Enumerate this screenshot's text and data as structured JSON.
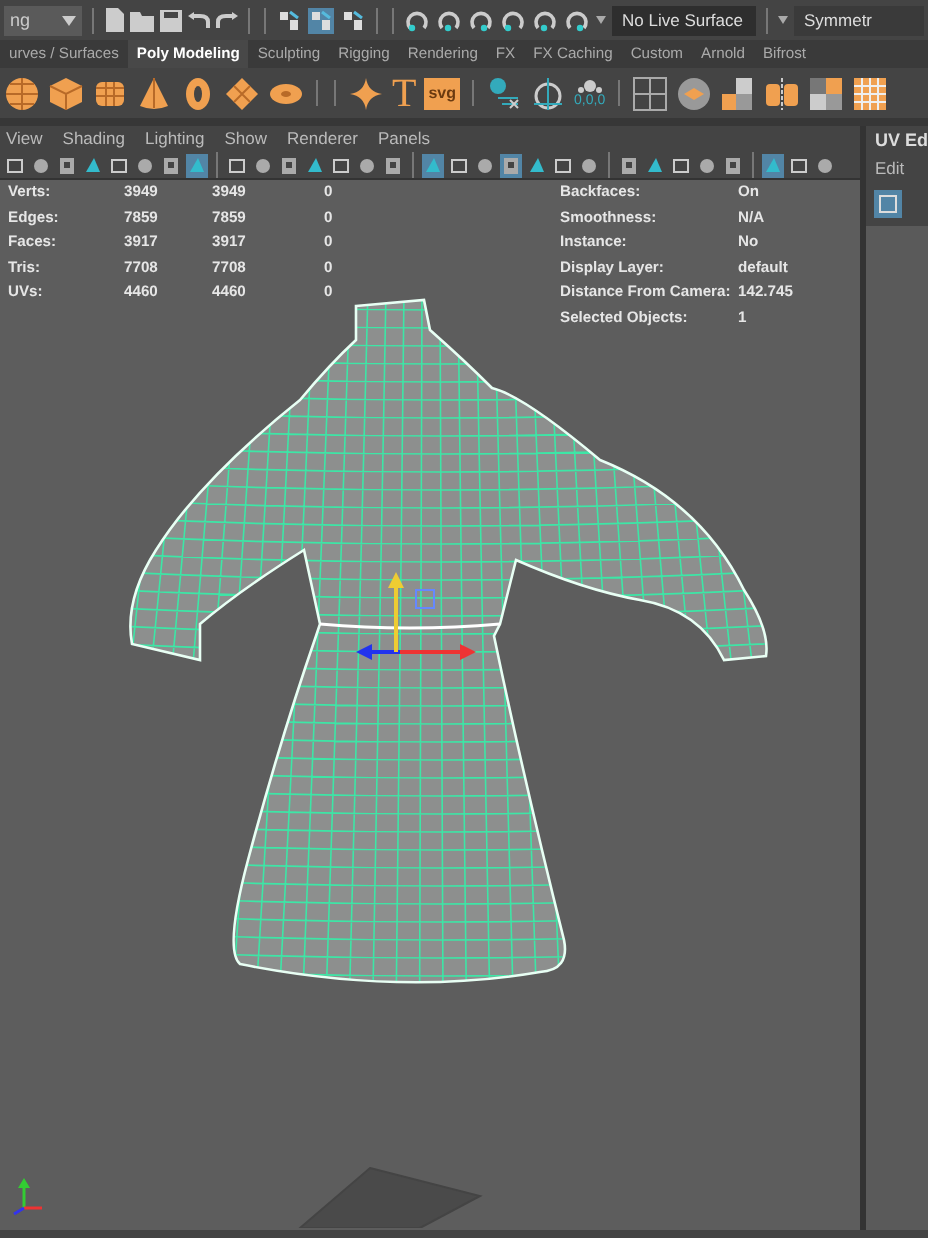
{
  "top_toolbar": {
    "mode_menu": "ng",
    "select_modes": [
      {
        "selected": false
      },
      {
        "selected": true
      },
      {
        "selected": false
      }
    ],
    "live_surface": "No Live Surface",
    "symmetry": "Symmetr"
  },
  "shelf_tabs": [
    {
      "label": "urves / Surfaces",
      "selected": false
    },
    {
      "label": "Poly Modeling",
      "selected": true
    },
    {
      "label": "Sculpting",
      "selected": false
    },
    {
      "label": "Rigging",
      "selected": false
    },
    {
      "label": "Rendering",
      "selected": false
    },
    {
      "label": "FX",
      "selected": false
    },
    {
      "label": "FX Caching",
      "selected": false
    },
    {
      "label": "Custom",
      "selected": false
    },
    {
      "label": "Arnold",
      "selected": false
    },
    {
      "label": "Bifrost",
      "selected": false
    }
  ],
  "shelf": {
    "text_tool": "T",
    "svg_tool": "svg",
    "position_readout": "0,0,0"
  },
  "viewport": {
    "menus": [
      "View",
      "Shading",
      "Lighting",
      "Show",
      "Renderer",
      "Panels"
    ],
    "toolbar": [
      {
        "selected": false
      },
      {
        "selected": false
      },
      {
        "selected": false
      },
      {
        "selected": false
      },
      {
        "selected": false
      },
      {
        "selected": false
      },
      {
        "selected": false
      },
      {
        "selected": true
      },
      {
        "selected": false
      },
      {
        "selected": false
      },
      {
        "selected": false
      },
      {
        "selected": false
      },
      {
        "selected": false
      },
      {
        "selected": false
      },
      {
        "selected": false
      },
      {
        "selected": true
      },
      {
        "selected": false
      },
      {
        "selected": false
      },
      {
        "selected": true
      },
      {
        "selected": false
      },
      {
        "selected": false
      },
      {
        "selected": false
      },
      {
        "selected": false
      },
      {
        "selected": false
      },
      {
        "selected": false
      },
      {
        "selected": false
      },
      {
        "selected": false
      },
      {
        "selected": true
      },
      {
        "selected": false
      },
      {
        "selected": false
      }
    ],
    "hud_stats": [
      {
        "label": "Verts:",
        "values": [
          "3949",
          "3949",
          "0"
        ]
      },
      {
        "label": "Edges:",
        "values": [
          "7859",
          "7859",
          "0"
        ]
      },
      {
        "label": "Faces:",
        "values": [
          "3917",
          "3917",
          "0"
        ]
      },
      {
        "label": "Tris:",
        "values": [
          "7708",
          "7708",
          "0"
        ]
      },
      {
        "label": "UVs:",
        "values": [
          "4460",
          "4460",
          "0"
        ]
      }
    ],
    "hud_info": [
      {
        "label": "Backfaces:",
        "value": "On"
      },
      {
        "label": "Smoothness:",
        "value": "N/A"
      },
      {
        "label": "Instance:",
        "value": "No"
      },
      {
        "label": "Display Layer:",
        "value": "default"
      },
      {
        "label": "Distance From Camera:",
        "value": "142.745"
      },
      {
        "label": "Selected Objects:",
        "value": "1"
      }
    ]
  },
  "uv_editor": {
    "title": "UV Ed",
    "menu": "Edit"
  }
}
